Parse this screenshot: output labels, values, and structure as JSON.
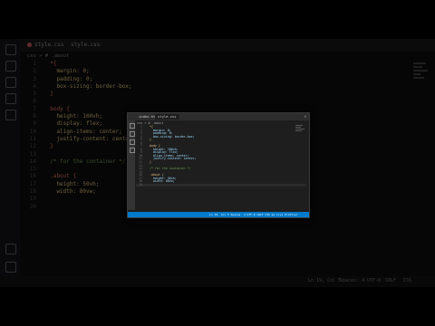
{
  "background_editor": {
    "tabs": [
      "style.css",
      "style.css"
    ],
    "breadcrumb": "css > # .about",
    "lines": [
      {
        "n": "1",
        "t": "  *{",
        "k": "sel"
      },
      {
        "n": "2",
        "t": "    margin: 0;",
        "k": ""
      },
      {
        "n": "3",
        "t": "    padding: 0;",
        "k": ""
      },
      {
        "n": "4",
        "t": "    box-sizing: border-box;",
        "k": ""
      },
      {
        "n": "5",
        "t": "  }",
        "k": "sel"
      },
      {
        "n": "6",
        "t": "",
        "k": ""
      },
      {
        "n": "7",
        "t": "  body {",
        "k": "sel"
      },
      {
        "n": "8",
        "t": "    height: 100vh;",
        "k": ""
      },
      {
        "n": "9",
        "t": "    display: flex;",
        "k": ""
      },
      {
        "n": "10",
        "t": "    align-items: center;",
        "k": ""
      },
      {
        "n": "11",
        "t": "    justify-content: center;",
        "k": ""
      },
      {
        "n": "12",
        "t": "  }",
        "k": "sel"
      },
      {
        "n": "13",
        "t": "",
        "k": ""
      },
      {
        "n": "14",
        "t": "  /* for the container */",
        "k": "cmt"
      },
      {
        "n": "15",
        "t": "",
        "k": ""
      },
      {
        "n": "16",
        "t": "  .about {",
        "k": "sel"
      },
      {
        "n": "17",
        "t": "    height: 50vh;",
        "k": ""
      },
      {
        "n": "18",
        "t": "    width: 80vw;",
        "k": ""
      },
      {
        "n": "19",
        "t": "",
        "k": ""
      },
      {
        "n": "20",
        "t": "",
        "k": ""
      }
    ],
    "status_right": [
      "Ln 19, Col 5",
      "Spaces: 4",
      "UTF-8",
      "CRLF",
      "CSS"
    ]
  },
  "inner_window": {
    "tabs": [
      "index.html",
      "style.css"
    ],
    "breadcrumb": "css > # .about",
    "lines": [
      {
        "n": "1",
        "t": "  *{",
        "k": "sel"
      },
      {
        "n": "2",
        "t": "    margin: 0;",
        "k": ""
      },
      {
        "n": "3",
        "t": "    padding: 0;",
        "k": ""
      },
      {
        "n": "4",
        "t": "    box-sizing: border-box;",
        "k": ""
      },
      {
        "n": "5",
        "t": "  }",
        "k": "sel"
      },
      {
        "n": "6",
        "t": "",
        "k": ""
      },
      {
        "n": "7",
        "t": "  body {",
        "k": "sel"
      },
      {
        "n": "8",
        "t": "    height: 100vh;",
        "k": ""
      },
      {
        "n": "9",
        "t": "    display: flex;",
        "k": ""
      },
      {
        "n": "10",
        "t": "    align-items: center;",
        "k": ""
      },
      {
        "n": "11",
        "t": "    justify-content: center;",
        "k": ""
      },
      {
        "n": "12",
        "t": "  }",
        "k": "sel"
      },
      {
        "n": "13",
        "t": "",
        "k": ""
      },
      {
        "n": "14",
        "t": "  /* for the container */",
        "k": "cmt"
      },
      {
        "n": "15",
        "t": "",
        "k": ""
      },
      {
        "n": "16",
        "t": "  .about {",
        "k": "sel"
      },
      {
        "n": "17",
        "t": "    height: 50vh;",
        "k": ""
      },
      {
        "n": "18",
        "t": "    width: 80vw;",
        "k": ""
      },
      {
        "n": "19",
        "t": "",
        "k": ""
      }
    ],
    "status": "Ln 19, Col 5  Spaces: 4  UTF-8  CRLF  CSS  Go Live  Prettier"
  },
  "colors": {
    "accent": "#007acc",
    "background": "#000000"
  }
}
